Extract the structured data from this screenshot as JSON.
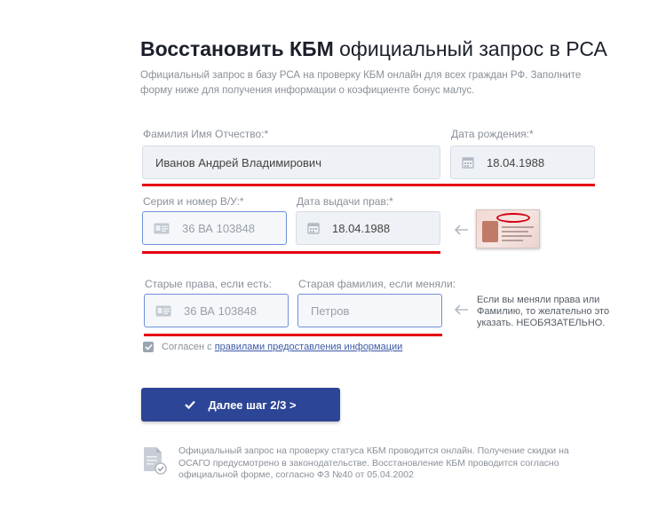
{
  "header": {
    "title_bold": "Восстановить КБМ",
    "title_rest": "официальный запрос в РСА",
    "subtitle": "Официальный запрос в базу РСА на проверку КБМ онлайн для всех граждан РФ. Заполните форму ниже для получения информации о коэфициенте бонус малус."
  },
  "form": {
    "fio": {
      "label": "Фамилия Имя Отчество:*",
      "value": "Иванов Андрей Владимирович"
    },
    "birth_date": {
      "label": "Дата рождения:*",
      "value": "18.04.1988"
    },
    "license_number": {
      "label": "Серия и номер В/У:*",
      "placeholder": "36 ВА 103848"
    },
    "license_issue_date": {
      "label": "Дата выдачи прав:*",
      "value": "18.04.1988"
    },
    "old_license": {
      "label": "Старые права, если есть:",
      "placeholder": "36 ВА 103848"
    },
    "old_surname": {
      "label": "Старая фамилия, если меняли:",
      "placeholder": "Петров"
    },
    "hint": "Если вы меняли права или Фамилию, то желательно это указать. НЕОБЯЗАТЕЛЬНО.",
    "consent": {
      "prefix": "Согласен с",
      "link": "правилами предоставления информации",
      "checked": true
    },
    "submit_label": "Далее шаг 2/3 >"
  },
  "footer": {
    "text": "Официальный запрос на проверку статуса КБМ проводится онлайн. Получение скидки на ОСАГО предусмотрено в законодательстве. Восстановление КБМ проводится согласно официальной форме, согласно ФЗ №40 от 05.04.2002"
  },
  "icons": {
    "calendar": "calendar-icon",
    "id_card": "id-card-icon",
    "arrow": "arrow-left-icon",
    "check": "check-icon",
    "document": "document-check-icon"
  },
  "colors": {
    "accent": "#2d4596",
    "underline": "#e4000f",
    "field_bg": "#eef1f5",
    "active_border": "#6f90d8",
    "link": "#3d5aa7"
  }
}
